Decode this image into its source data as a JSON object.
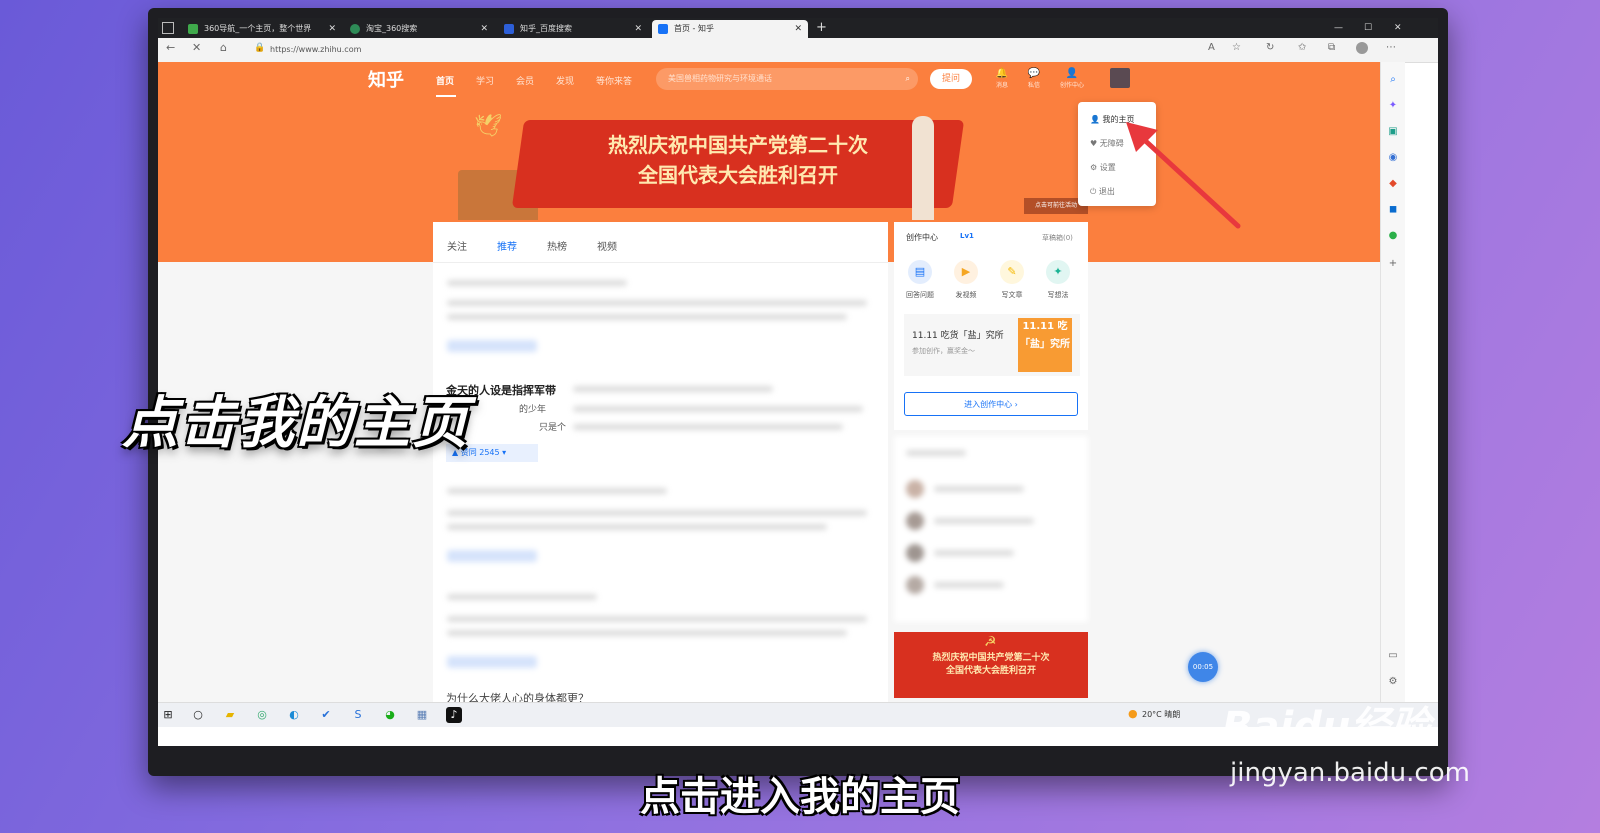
{
  "colors": {
    "zhihu_orange": "#fb7f3e",
    "zhihu_blue": "#1772f6",
    "party_red": "#d8301f"
  },
  "browser": {
    "tabs": [
      {
        "title": "360导航_一个主页，整个世界",
        "icon": "globe-icon"
      },
      {
        "title": "淘宝_360搜索",
        "icon": "search-icon"
      },
      {
        "title": "知乎_百度搜索",
        "icon": "paw-icon"
      },
      {
        "title": "首页 - 知乎",
        "icon": "zhihu-icon",
        "active": true
      }
    ],
    "url": "https://www.zhihu.com"
  },
  "zhihu": {
    "logo": "知乎",
    "nav": [
      "首页",
      "学习",
      "会员",
      "发现",
      "等你来答"
    ],
    "search_placeholder": "美国兽相药物研究与环境通话",
    "ask_button": "提问",
    "header_icons": [
      {
        "label": "消息",
        "icon": "bell-icon"
      },
      {
        "label": "私信",
        "icon": "chat-icon"
      },
      {
        "label": "创作中心",
        "icon": "creator-icon"
      }
    ],
    "banner_line1": "热烈庆祝中国共产党第二十次",
    "banner_line2": "全国代表大会胜利召开",
    "banner_link": "点击可前往活动",
    "dropdown": [
      {
        "label": "我的主页",
        "icon": "user-icon"
      },
      {
        "label": "无障碍",
        "icon": "heart-icon"
      },
      {
        "label": "设置",
        "icon": "gear-icon"
      },
      {
        "label": "退出",
        "icon": "power-icon"
      }
    ],
    "feed_tabs": [
      "关注",
      "推荐",
      "热榜",
      "视频"
    ],
    "feed_card_title": "金天的人设是指挥军带",
    "feed_card_line1": "的少年",
    "feed_card_line2": "只是个",
    "feed_vote": "赞同 2545",
    "feed_bottom_title": "为什么大佬人心的身体都更？",
    "creator": {
      "title": "创作中心",
      "level": "Lv1",
      "drafts": "草稿箱(0)",
      "actions": [
        "回答问题",
        "发视频",
        "写文章",
        "写想法"
      ],
      "promo_title": "11.11 吃货「盐」究所",
      "promo_sub": "参加创作，赢奖金～",
      "promo_img": "11.11 吃「盐」究所",
      "enter": "进入创作中心 ›"
    },
    "ad_line1": "热烈庆祝中国共产党第二十次",
    "ad_line2": "全国代表大会胜利召开",
    "timer": "00:05"
  },
  "taskbar": {
    "weather": "20°C 晴朗"
  },
  "overlay_text": "点击我的主页",
  "subtitle": "点击进入我的主页",
  "watermark": "Baidu经验",
  "watermark_url": "jingyan.baidu.com"
}
